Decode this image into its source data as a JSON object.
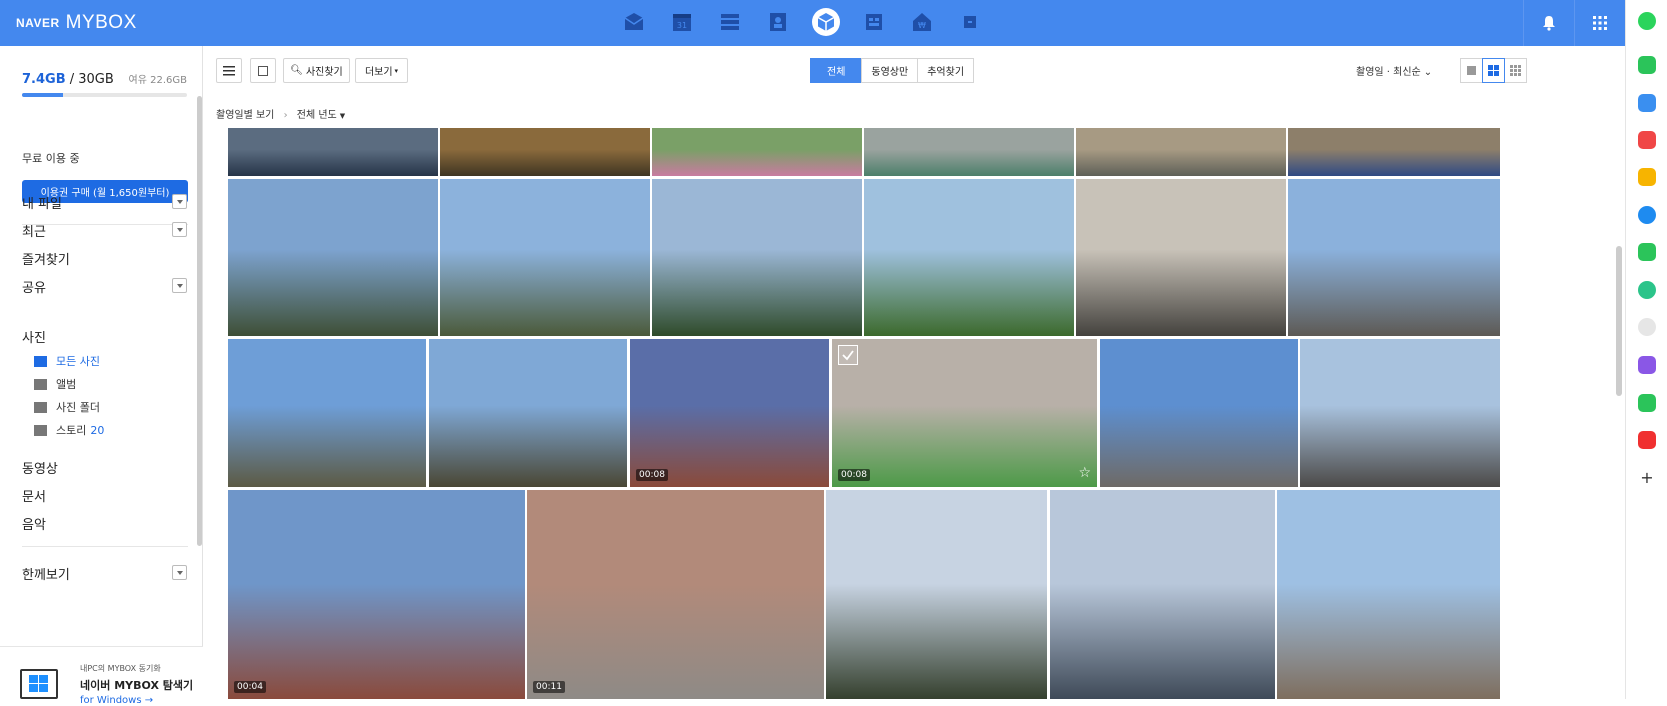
{
  "brand": {
    "naver": "NAVER",
    "mybox": "MYBOX"
  },
  "topbar": {
    "apps": [
      "mail-icon",
      "calendar-icon",
      "list-icon",
      "contacts-icon",
      "mybox-icon",
      "memo-icon",
      "home-icon",
      "more-icon"
    ],
    "active_app": "mybox-icon"
  },
  "storage": {
    "used": "7.4GB",
    "separator": " / ",
    "total": "30GB",
    "free": "여유 22.6GB",
    "used_fraction": 0.25
  },
  "trash_label": "무료 이용 중",
  "buy_button": "이용권 구매 (월 1,650원부터)",
  "nav": {
    "my_files": "내 파일",
    "recent": "최근",
    "bookmarks": "즐겨찾기",
    "shared": "공유",
    "photos_header": "사진",
    "all_photos": "모든 사진",
    "albums": "앨범",
    "photo_folders": "사진 폴더",
    "stories": "스토리",
    "stories_count": "20",
    "videos": "동영상",
    "documents": "문서",
    "music": "음악",
    "grouped_view": "한께보기"
  },
  "promo": {
    "line1": "내PC의 MYBOX 동기화",
    "line2": "네이버 MYBOX 탐색기",
    "line3": "for Windows →"
  },
  "toolbar": {
    "search_label": "사진찾기",
    "more_label": "더보기",
    "filters": [
      "전체",
      "동영상만",
      "추억찾기"
    ],
    "sort_label": "촬영일 · 최신순"
  },
  "breadcrumb": {
    "view_by_date": "촬영일별 보기",
    "year_filter": "전체 년도"
  },
  "photos": [
    {
      "theme": "sky-crowd-top"
    },
    {
      "theme": "garden-top"
    },
    {
      "theme": "flower-top"
    },
    {
      "theme": "path-top"
    },
    {
      "theme": "fountain-top"
    },
    {
      "theme": "market-top"
    },
    {
      "theme": "tree-plaza"
    },
    {
      "theme": "tree-plaza-2"
    },
    {
      "theme": "park-view"
    },
    {
      "theme": "green-park"
    },
    {
      "theme": "street-crowd"
    },
    {
      "theme": "ferris-plaza"
    },
    {
      "theme": "stage-sky"
    },
    {
      "theme": "lights-stage"
    },
    {
      "theme": "performance",
      "duration": "00:08"
    },
    {
      "theme": "queue-turf",
      "duration": "00:08",
      "selected": true,
      "starred": true
    },
    {
      "theme": "colorful-stand"
    },
    {
      "theme": "building-street"
    },
    {
      "theme": "umbrellas",
      "duration": "00:04"
    },
    {
      "theme": "brick-path",
      "duration": "00:11"
    },
    {
      "theme": "coaster-sky"
    },
    {
      "theme": "castle-sky"
    },
    {
      "theme": "castle-crowd"
    }
  ],
  "colors": {
    "brand_blue": "#4488ee",
    "link_blue": "#1e6be3"
  }
}
